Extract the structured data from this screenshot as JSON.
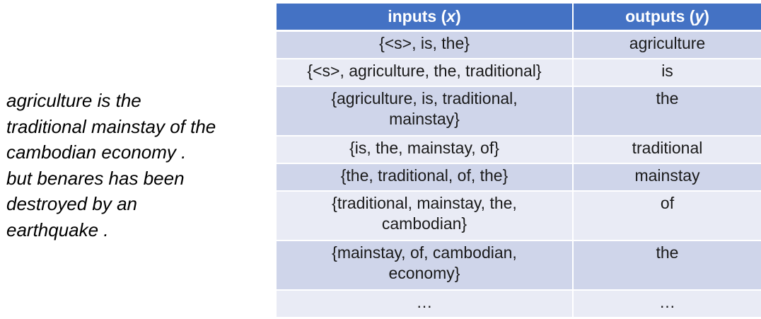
{
  "sentence": {
    "lines": [
      "agriculture is the",
      "traditional mainstay of the",
      "cambodian economy .",
      "but benares has been",
      "destroyed by an",
      "earthquake ."
    ]
  },
  "table": {
    "headers": {
      "inputs_word": "inputs",
      "inputs_var": "x",
      "outputs_word": "outputs",
      "outputs_var": "y"
    },
    "rows": [
      {
        "input": "{<s>, is, the}",
        "output": "agriculture"
      },
      {
        "input": "{<s>, agriculture, the, traditional}",
        "output": "is"
      },
      {
        "input_line1": "{agriculture, is, traditional,",
        "input_line2": "mainstay}",
        "output": "the"
      },
      {
        "input": "{is, the, mainstay, of}",
        "output": "traditional"
      },
      {
        "input": "{the, traditional, of, the}",
        "output": "mainstay"
      },
      {
        "input_line1": "{traditional, mainstay, the,",
        "input_line2": "cambodian}",
        "output": "of"
      },
      {
        "input_line1": "{mainstay, of, cambodian,",
        "input_line2": "economy}",
        "output": "the"
      },
      {
        "input": "…",
        "output": "…"
      }
    ]
  },
  "colors": {
    "header_bg": "#4472c4",
    "row_dark": "#cfd5ea",
    "row_light": "#e9ebf5"
  }
}
